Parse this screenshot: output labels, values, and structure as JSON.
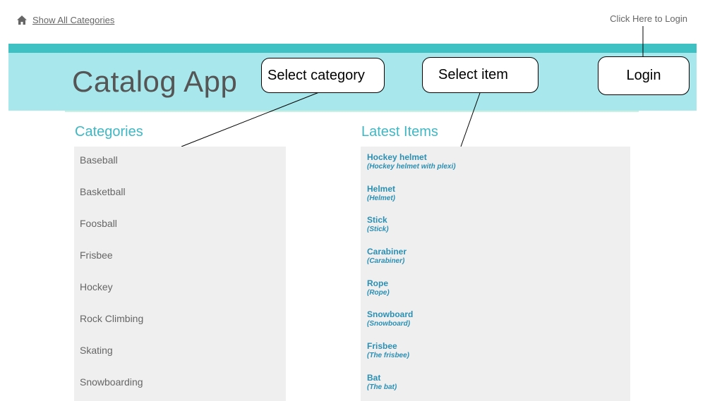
{
  "nav": {
    "home_label": "Show All Categories",
    "login_link": "Click Here to Login"
  },
  "header": {
    "title": "Catalog App"
  },
  "callouts": {
    "select_category": "Select category",
    "select_item": "Select item",
    "login": "Login"
  },
  "categories": {
    "title": "Categories",
    "items": [
      "Baseball",
      "Basketball",
      "Foosball",
      "Frisbee",
      "Hockey",
      "Rock Climbing",
      "Skating",
      "Snowboarding"
    ]
  },
  "latest": {
    "title": "Latest Items",
    "items": [
      {
        "name": "Hockey helmet",
        "desc": "(Hockey helmet with plexi)"
      },
      {
        "name": "Helmet",
        "desc": "(Helmet)"
      },
      {
        "name": "Stick",
        "desc": "(Stick)"
      },
      {
        "name": "Carabiner",
        "desc": "(Carabiner)"
      },
      {
        "name": "Rope",
        "desc": "(Rope)"
      },
      {
        "name": "Snowboard",
        "desc": "(Snowboard)"
      },
      {
        "name": "Frisbee",
        "desc": "(The frisbee)"
      },
      {
        "name": "Bat",
        "desc": "(The bat)"
      }
    ]
  },
  "colors": {
    "band": "#a8e8ec",
    "band_accent": "#3fc1c3",
    "heading": "#3fb8c4",
    "link": "#2a8fb3"
  },
  "icons": {
    "home": "home-icon"
  }
}
